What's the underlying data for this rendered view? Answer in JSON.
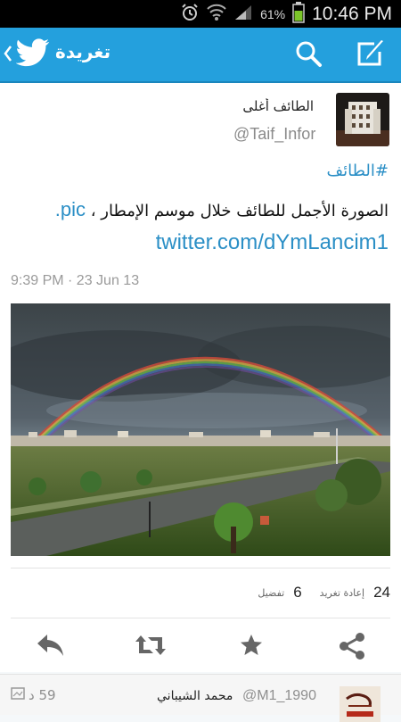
{
  "status_bar": {
    "battery_percent": "61%",
    "time": "10:46 PM"
  },
  "header": {
    "title": "تغريدة",
    "accent": "#24a0dd"
  },
  "tweet": {
    "author_name": "الطائف أغلى",
    "author_handle": "@Taif_Infor",
    "hashtag": "#الطائف",
    "text": "الصورة الأجمل للطائف خلال موسم الإمطار ،",
    "link_part1": "pic.",
    "link_part2": "twitter.com/dYmLancim1",
    "timestamp": "9:39 PM · 23 Jun 13",
    "retweets_count": "24",
    "retweets_label": "إعادة تغريد",
    "favorites_count": "6",
    "favorites_label": "تفضيل",
    "link_color": "#2b8fc6"
  },
  "actions": {
    "reply_icon": "reply-icon",
    "retweet_icon": "retweet-icon",
    "favorite_icon": "star-icon",
    "share_icon": "share-icon"
  },
  "next_tweet": {
    "name": "محمد الشيباني",
    "handle": "@M1_1990",
    "time": "59 د"
  }
}
